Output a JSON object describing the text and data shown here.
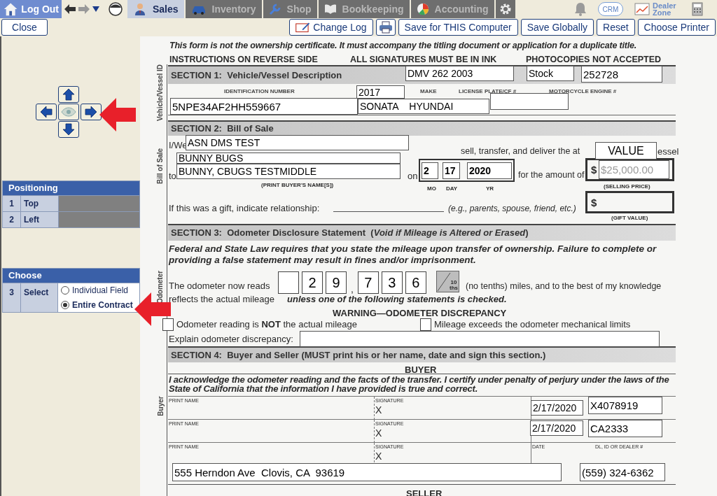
{
  "top_bar": {
    "logout": "Log Out",
    "tabs": [
      {
        "label": "Sales",
        "selected": true
      },
      {
        "label": "Inventory",
        "selected": false
      },
      {
        "label": "Shop",
        "selected": false
      },
      {
        "label": "Bookkeeping",
        "selected": false
      },
      {
        "label": "Accounting",
        "selected": false
      }
    ],
    "crm": "CRM",
    "dealer_zone": "Dealer Zone"
  },
  "action_bar": {
    "close": "Close",
    "change_log": "Change Log",
    "buttons": [
      "Save for THIS Computer",
      "Save Globally",
      "Reset",
      "Choose Printer"
    ]
  },
  "positioning": {
    "title": "Positioning",
    "rows": [
      {
        "number": "1",
        "label": "Top"
      },
      {
        "number": "2",
        "label": "Left"
      }
    ]
  },
  "choose": {
    "title": "Choose",
    "number": "3",
    "label": "Select",
    "options": [
      {
        "label": "Individual Field",
        "selected": false
      },
      {
        "label": "Entire Contract",
        "selected": true
      }
    ]
  },
  "document": {
    "notice": "This form is not the ownership certificate. It must accompany the titling document or application for a duplicate title.",
    "header_notes": [
      "INSTRUCTIONS ON REVERSE SIDE",
      "ALL SIGNATURES MUST BE IN INK",
      "PHOTOCOPIES NOT ACCEPTED"
    ],
    "side_labels": [
      "Vehicle/Vessel ID",
      "Bill of Sale",
      "Odometer",
      "Buyer"
    ],
    "sections": [
      "SECTION 1:  Vehicle/Vessel Description",
      "SECTION 2:  Bill of Sale",
      "SECTION 3:  Odometer Disclosure Statement  (*Void if Mileage is Altered or Erased*)",
      "SECTION 4:  Buyer and Seller (MUST print his or her name, date and sign this section.)"
    ],
    "column_labels": [
      "IDENTIFICATION NUMBER",
      "MAKE",
      "LICENSE PLATE/CF #",
      "MOTORCYCLE ENGINE #"
    ],
    "bill_of_sale": {
      "prefix": "I/We",
      "transfer_text": "sell, transfer, and deliver the at",
      "transfer_tail": "essel",
      "to": "to",
      "on": "on",
      "amount_label": "for the amount of",
      "buyer_caption": "(PRINT BUYER'S NAME[S])",
      "date_captions": [
        "MO",
        "DAY",
        "YR"
      ],
      "currency": "$",
      "price_caption": "(SELLING PRICE)",
      "gift_label": "If this was a gift, indicate relationship:",
      "gift_hint": "(e.g., parents, spouse, friend, etc.)",
      "gift_currency": "$",
      "gift_caption": "(GIFT VALUE)"
    },
    "odometer": {
      "statement": "Federal and State Law requires that you state the mileage upon transfer of ownership. Failure to complete or providing a false statement may result in fines and/or imprisonment.",
      "reads_label": "The odometer now reads",
      "digits": [
        "2",
        "9",
        "7",
        "3",
        "6"
      ],
      "separator": ",",
      "tenths": "10",
      "tenths_unit": "ths",
      "after": "(no tenths) miles, and to the best of my knowledge",
      "reflects": "reflects the actual mileage",
      "reflects_emphasis": "unless one of the following statements is checked.",
      "warning": "WARNING—ODOMETER DISCREPANCY",
      "options": [
        {
          "label": "Odometer reading is **NOT** the actual mileage",
          "checked": false
        },
        {
          "label": "Mileage exceeds the odometer mechanical limits",
          "checked": false
        }
      ],
      "explain_label": "Explain odometer discrepancy:"
    },
    "buyer": {
      "heading": "BUYER",
      "certification": "I acknowledge the odometer reading and the facts of the transfer. I certify under penalty of perjury under the laws of the State of California that the information I have provided is true and correct.",
      "rows": [
        {
          "name_label": "PRINT NAME",
          "signature_label": "SIGNATURE",
          "sign_mark": "X"
        },
        {
          "name_label": "PRINT NAME",
          "signature_label": "SIGNATURE",
          "sign_mark": "X"
        },
        {
          "name_label": "PRINT NAME",
          "signature_label": "SIGNATURE",
          "sign_mark": "X",
          "date_label": "DATE",
          "id_label": "DL, ID OR DEALER #"
        }
      ],
      "next_heading": "SELLER"
    },
    "fields": [
      {
        "kind": "text",
        "value": "DMV 262 2003"
      },
      {
        "kind": "text",
        "value": "Stock"
      },
      {
        "kind": "text",
        "value": "252728"
      },
      {
        "kind": "text",
        "value": "2017"
      },
      {
        "kind": "text",
        "value": "5NPE34AF2HH559667"
      },
      {
        "kind": "text",
        "value": "SONATA    HYUNDAI"
      },
      {
        "kind": "blank"
      },
      {
        "kind": "text",
        "value": "ASN DMS TEST"
      },
      {
        "kind": "text",
        "value": "VALUE"
      },
      {
        "kind": "text",
        "value": "BUNNY BUGS"
      },
      {
        "kind": "text",
        "value": "BUNNY, CBUGS TESTMIDDLE"
      },
      {
        "kind": "text",
        "value": "2"
      },
      {
        "kind": "text",
        "value": "17"
      },
      {
        "kind": "text",
        "value": "2020"
      },
      {
        "kind": "hint",
        "placeholder": "$25,000.00"
      },
      {
        "kind": "blank"
      },
      {
        "kind": "text",
        "value": "2/17/2020"
      },
      {
        "kind": "text",
        "value": "X4078919"
      },
      {
        "kind": "text",
        "value": "2/17/2020"
      },
      {
        "kind": "text",
        "value": "CA2333"
      },
      {
        "kind": "text",
        "value": "555 Herndon Ave  Clovis, CA  93619"
      },
      {
        "kind": "text",
        "value": "(559) 324-6362"
      }
    ]
  }
}
